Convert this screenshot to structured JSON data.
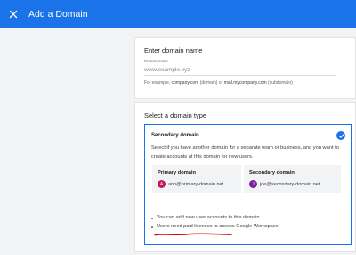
{
  "dialog": {
    "title": "Add a Domain"
  },
  "domain_name_section": {
    "title": "Enter domain name",
    "field_label": "Domain name",
    "placeholder": "www.example.xyz",
    "hint_prefix": "For example, ",
    "hint_example1": "company.com",
    "hint_mid1": " (domain) or ",
    "hint_example2": "mail.mycompany.com",
    "hint_suffix": " (subdomain)"
  },
  "domain_type_section": {
    "title": "Select a domain type",
    "option": {
      "title": "Secondary domain",
      "selected": true,
      "description": "Select if you have another domain for a separate team or business, and you want to create accounts at this domain for new users.",
      "primary": {
        "label": "Primary domain",
        "avatar_letter": "A",
        "email": "ann@primary-domain.net"
      },
      "secondary": {
        "label": "Secondary domain",
        "avatar_letter": "J",
        "email": "joe@secondary-domain.net"
      },
      "bullets": [
        "You can add new user accounts to this domain",
        "Users need paid licenses to access Google Workspace"
      ]
    }
  },
  "colors": {
    "accent": "#1a73e8",
    "annotation": "#d50000"
  },
  "icons": {
    "close": "close-icon",
    "check": "check-circle-icon"
  }
}
